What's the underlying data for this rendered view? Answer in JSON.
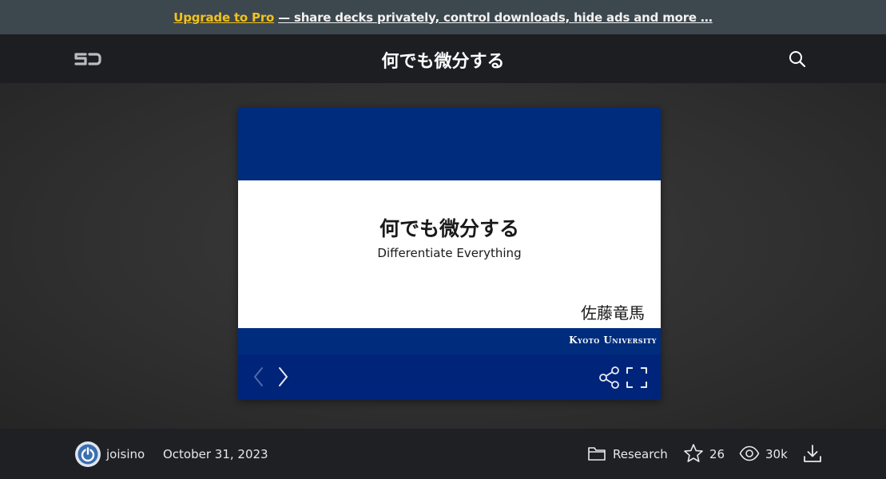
{
  "promo": {
    "link_label": "Upgrade to Pro",
    "text": "— share decks privately, control downloads, hide ads and more …"
  },
  "header": {
    "logo_icon": "speakerdeck-logo-icon",
    "title": "何でも微分する",
    "search_icon": "search-icon"
  },
  "slide": {
    "title": "何でも微分する",
    "subtitle": "Differentiate Everything",
    "author": "佐藤竜馬",
    "institution": "Kyoto University",
    "colors": {
      "band": "#002c7d",
      "controls": "#00247a"
    },
    "controls": {
      "prev_icon": "chevron-left-icon",
      "next_icon": "chevron-right-icon",
      "share_icon": "share-icon",
      "fullscreen_icon": "fullscreen-icon"
    }
  },
  "footer": {
    "username": "joisino",
    "date": "October 31, 2023",
    "category": "Research",
    "stars": "26",
    "views": "30k"
  },
  "colors": {
    "accent": "#f2c21b",
    "promo_bg": "#3d474e",
    "header_bg": "#1d1e22"
  }
}
